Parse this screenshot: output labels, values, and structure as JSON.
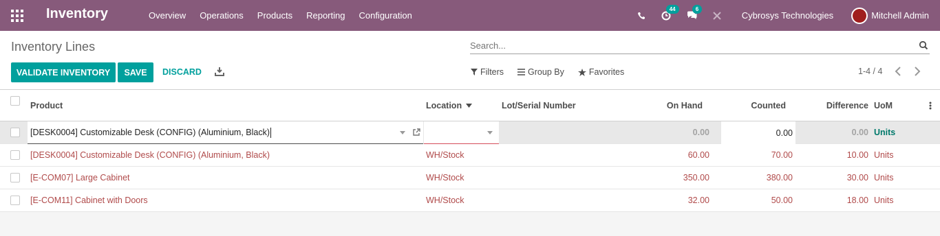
{
  "navbar": {
    "brand": "Inventory",
    "menu": [
      "Overview",
      "Operations",
      "Products",
      "Reporting",
      "Configuration"
    ],
    "activity_count": "44",
    "message_count": "6",
    "company": "Cybrosys Technologies",
    "user": "Mitchell Admin"
  },
  "control": {
    "breadcrumb": "Inventory Lines",
    "search_placeholder": "Search...",
    "validate_label": "VALIDATE INVENTORY",
    "save_label": "SAVE",
    "discard_label": "DISCARD",
    "filters_label": "Filters",
    "groupby_label": "Group By",
    "favorites_label": "Favorites",
    "pager": "1-4 / 4"
  },
  "table": {
    "headers": {
      "product": "Product",
      "location": "Location",
      "lot": "Lot/Serial Number",
      "on_hand": "On Hand",
      "counted": "Counted",
      "difference": "Difference",
      "uom": "UoM"
    },
    "edit_row": {
      "product": "[DESK0004] Customizable Desk (CONFIG) (Aluminium, Black)",
      "on_hand": "0.00",
      "counted": "0.00",
      "difference": "0.00",
      "uom": "Units"
    },
    "rows": [
      {
        "product": "[DESK0004] Customizable Desk (CONFIG) (Aluminium, Black)",
        "location": "WH/Stock",
        "on_hand": "60.00",
        "counted": "70.00",
        "difference": "10.00",
        "uom": "Units"
      },
      {
        "product": "[E-COM07] Large Cabinet",
        "location": "WH/Stock",
        "on_hand": "350.00",
        "counted": "380.00",
        "difference": "30.00",
        "uom": "Units"
      },
      {
        "product": "[E-COM11] Cabinet with Doors",
        "location": "WH/Stock",
        "on_hand": "32.00",
        "counted": "50.00",
        "difference": "18.00",
        "uom": "Units"
      }
    ]
  },
  "colors": {
    "brand": "#875a7b",
    "accent": "#00a09d",
    "link_red": "#b04a4a"
  }
}
